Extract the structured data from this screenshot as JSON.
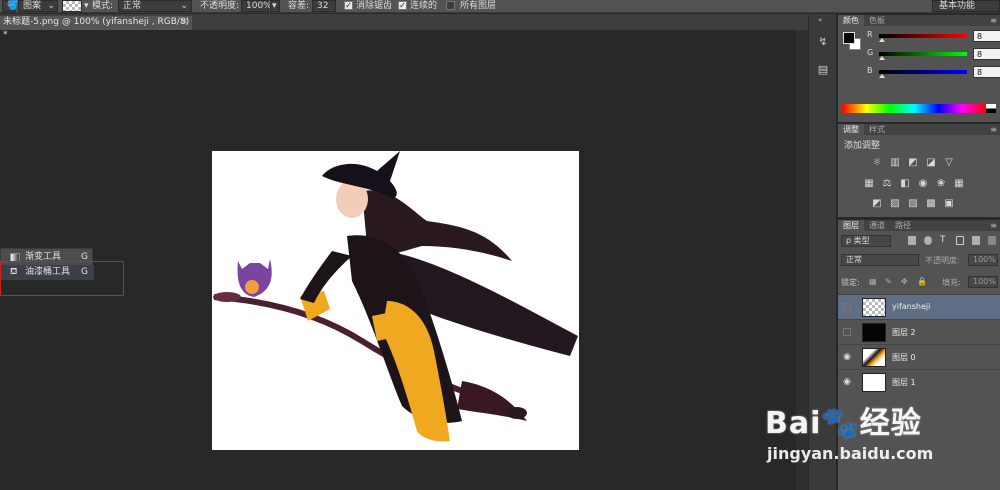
{
  "options_bar": {
    "mode_select": "图案",
    "mode_label": "模式:",
    "blend_mode": "正常",
    "opacity_label": "不透明度:",
    "opacity_value": "100%",
    "tolerance_label": "容差:",
    "tolerance_value": "32",
    "antialias_label": "消除锯齿",
    "antialias_checked": true,
    "contiguous_label": "连续的",
    "contiguous_checked": true,
    "all_layers_label": "所有图层",
    "all_layers_checked": false,
    "shortcut_key": "G",
    "workspace": "基本功能"
  },
  "document": {
    "tab_title": "未标题-5.png @ 100% (yifansheji , RGB/8) *",
    "close_glyph": "×"
  },
  "tool_flyout": {
    "items": [
      {
        "label": "渐变工具",
        "key": "G",
        "icon": "gradient-icon"
      },
      {
        "label": "油漆桶工具",
        "key": "G",
        "icon": "paint-bucket-icon"
      }
    ]
  },
  "color_panel": {
    "tabs": [
      "颜色",
      "色板"
    ],
    "foreground": "#080808",
    "background": "#ffffff",
    "channels": [
      {
        "label": "R",
        "value": "8"
      },
      {
        "label": "G",
        "value": "8"
      },
      {
        "label": "B",
        "value": "8"
      }
    ]
  },
  "adjustments_panel": {
    "tabs": [
      "调整",
      "样式"
    ],
    "title": "添加调整"
  },
  "layers_panel": {
    "tabs": [
      "图层",
      "通道",
      "路径"
    ],
    "filter_label": "ρ 类型",
    "blend_mode": "正常",
    "opacity_label": "不透明度:",
    "opacity_value": "100%",
    "lock_label": "锁定:",
    "fill_label": "填充:",
    "fill_value": "100%",
    "layers": [
      {
        "name": "yifansheji",
        "visible": false,
        "selected": true,
        "thumb": "transparent"
      },
      {
        "name": "图层 2",
        "visible": false,
        "selected": false,
        "thumb": "black"
      },
      {
        "name": "图层 0",
        "visible": true,
        "selected": false,
        "thumb": "witch"
      },
      {
        "name": "图层 1",
        "visible": true,
        "selected": false,
        "thumb": "white"
      }
    ]
  },
  "watermark": {
    "brand": "Bai🐾经验",
    "url": "jingyan.baidu.com"
  },
  "colors": {
    "ui_dark": "#282828",
    "panel": "#535353",
    "selected_layer": "#5f6e85",
    "highlight_box": "#d02020",
    "dress_yellow": "#f0a820",
    "dress_black": "#1c1418",
    "broom": "#5a2838"
  }
}
